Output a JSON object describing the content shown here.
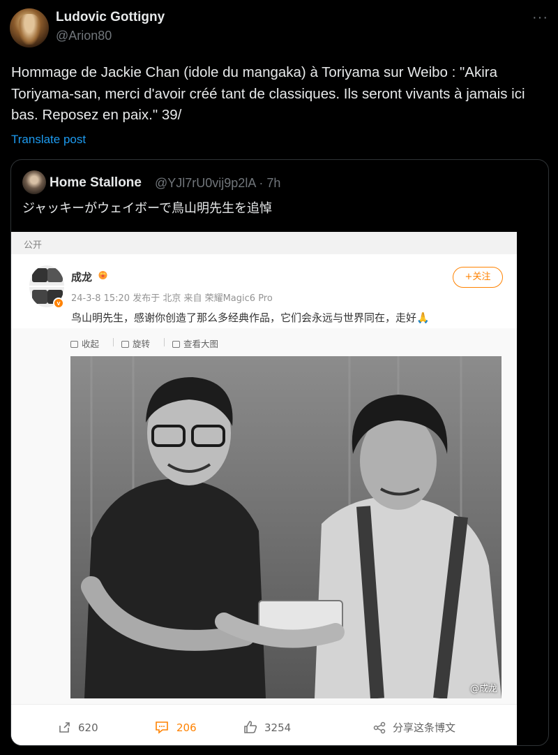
{
  "author": {
    "name": "Ludovic Gottigny",
    "handle": "@Arion80"
  },
  "post": {
    "text": "Hommage de Jackie Chan (idole du mangaka) à Toriyama sur Weibo : \"Akira Toriyama-san, merci d'avoir créé tant de classiques. Ils seront vivants à jamais ici bas. Reposez en paix.\" 39/",
    "translate_label": "Translate post",
    "more_label": "···"
  },
  "quoted": {
    "name": "Home Stallone",
    "meta": "@YJl7rU0vij9p2lA · 7h",
    "text": "ジャッキーがウェイボーで鳥山明先生を追悼"
  },
  "weibo": {
    "visibility": "公开",
    "name": "成龙",
    "timestamp": "24-3-8 15:20 发布于 北京 来自 荣耀Magic6 Pro",
    "follow_label": "+关注",
    "body": "鸟山明先生，感谢你创造了那么多经典作品，它们会永远与世界同在，走好🙏",
    "tools": [
      "收起",
      "旋转",
      "查看大图"
    ],
    "watermark": "@成龙",
    "footer": {
      "share_count": "620",
      "comment_count": "206",
      "like_count": "3254",
      "share_label": "分享这条博文"
    },
    "accent_color": "#ff8200"
  },
  "icons": [
    "more-icon",
    "crown-icon",
    "collapse-icon",
    "rotate-icon",
    "view-large-icon",
    "share-icon",
    "comment-icon",
    "like-icon",
    "share-post-icon"
  ]
}
